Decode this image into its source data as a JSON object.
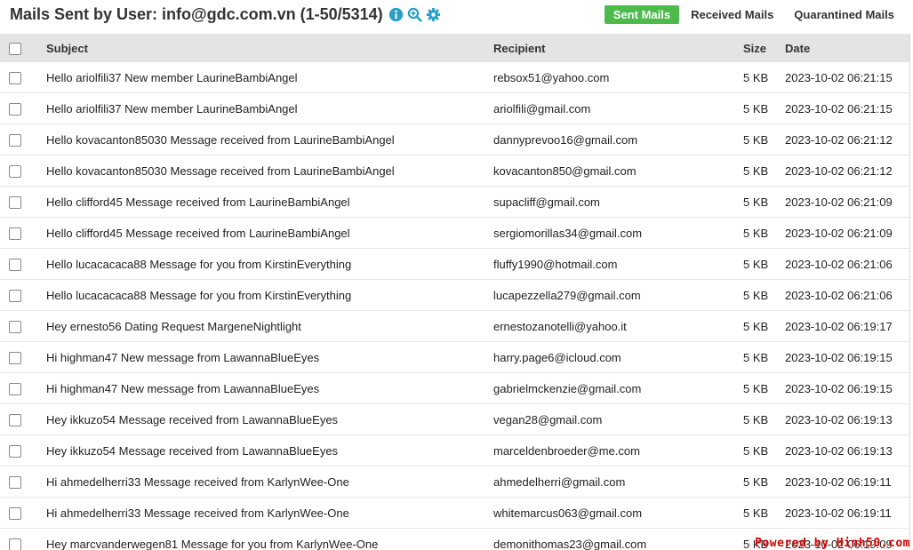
{
  "header": {
    "title": "Mails Sent by User: info@gdc.com.vn (1-50/5314)",
    "icons": [
      "info-icon",
      "zoom-in-icon",
      "gear-icon"
    ],
    "tabs": [
      {
        "label": "Sent Mails",
        "active": true
      },
      {
        "label": "Received Mails",
        "active": false
      },
      {
        "label": "Quarantined Mails",
        "active": false
      }
    ]
  },
  "colors": {
    "accent": "#2ba0c7",
    "active_tab": "#4cbb4c",
    "header_bg": "#e4e4e4",
    "watermark": "#d40000"
  },
  "table": {
    "columns": [
      "Subject",
      "Recipient",
      "Size",
      "Date"
    ],
    "rows": [
      {
        "subject": "Hello ariolfili37 New member LaurineBambiAngel",
        "recipient": "rebsox51@yahoo.com",
        "size": "5 KB",
        "date": "2023-10-02 06:21:15"
      },
      {
        "subject": "Hello ariolfili37 New member LaurineBambiAngel",
        "recipient": "ariolfili@gmail.com",
        "size": "5 KB",
        "date": "2023-10-02 06:21:15"
      },
      {
        "subject": "Hello kovacanton85030 Message received from LaurineBambiAngel",
        "recipient": "dannyprevoo16@gmail.com",
        "size": "5 KB",
        "date": "2023-10-02 06:21:12"
      },
      {
        "subject": "Hello kovacanton85030 Message received from LaurineBambiAngel",
        "recipient": "kovacanton850@gmail.com",
        "size": "5 KB",
        "date": "2023-10-02 06:21:12"
      },
      {
        "subject": "Hello clifford45 Message received from LaurineBambiAngel",
        "recipient": "supacliff@gmail.com",
        "size": "5 KB",
        "date": "2023-10-02 06:21:09"
      },
      {
        "subject": "Hello clifford45 Message received from LaurineBambiAngel",
        "recipient": "sergiomorillas34@gmail.com",
        "size": "5 KB",
        "date": "2023-10-02 06:21:09"
      },
      {
        "subject": "Hello lucacacaca88 Message for you from KirstinEverything",
        "recipient": "fluffy1990@hotmail.com",
        "size": "5 KB",
        "date": "2023-10-02 06:21:06"
      },
      {
        "subject": "Hello lucacacaca88 Message for you from KirstinEverything",
        "recipient": "lucapezzella279@gmail.com",
        "size": "5 KB",
        "date": "2023-10-02 06:21:06"
      },
      {
        "subject": "Hey ernesto56 Dating Request MargeneNightlight",
        "recipient": "ernestozanotelli@yahoo.it",
        "size": "5 KB",
        "date": "2023-10-02 06:19:17"
      },
      {
        "subject": "Hi highman47 New message from LawannaBlueEyes",
        "recipient": "harry.page6@icloud.com",
        "size": "5 KB",
        "date": "2023-10-02 06:19:15"
      },
      {
        "subject": "Hi highman47 New message from LawannaBlueEyes",
        "recipient": "gabrielmckenzie@gmail.com",
        "size": "5 KB",
        "date": "2023-10-02 06:19:15"
      },
      {
        "subject": "Hey ikkuzo54 Message received from LawannaBlueEyes",
        "recipient": "vegan28@gmail.com",
        "size": "5 KB",
        "date": "2023-10-02 06:19:13"
      },
      {
        "subject": "Hey ikkuzo54 Message received from LawannaBlueEyes",
        "recipient": "marceldenbroeder@me.com",
        "size": "5 KB",
        "date": "2023-10-02 06:19:13"
      },
      {
        "subject": "Hi ahmedelherri33 Message received from KarlynWee-One",
        "recipient": "ahmedelherri@gmail.com",
        "size": "5 KB",
        "date": "2023-10-02 06:19:11"
      },
      {
        "subject": "Hi ahmedelherri33 Message received from KarlynWee-One",
        "recipient": "whitemarcus063@gmail.com",
        "size": "5 KB",
        "date": "2023-10-02 06:19:11"
      },
      {
        "subject": "Hey marcvanderwegen81 Message for you from KarlynWee-One",
        "recipient": "demonithomas23@gmail.com",
        "size": "5 KB",
        "date": "2023-10-02 06:19:09"
      }
    ]
  },
  "watermark": "Powered by Hinh50.com"
}
